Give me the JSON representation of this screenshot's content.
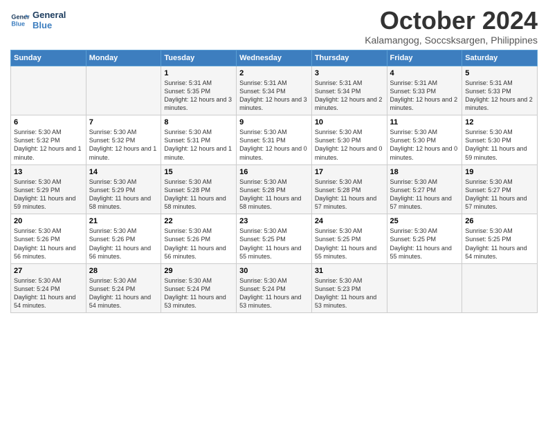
{
  "header": {
    "logo_line1": "General",
    "logo_line2": "Blue",
    "month": "October 2024",
    "location": "Kalamangog, Soccsksargen, Philippines"
  },
  "days_of_week": [
    "Sunday",
    "Monday",
    "Tuesday",
    "Wednesday",
    "Thursday",
    "Friday",
    "Saturday"
  ],
  "weeks": [
    [
      {
        "day": "",
        "info": ""
      },
      {
        "day": "",
        "info": ""
      },
      {
        "day": "1",
        "info": "Sunrise: 5:31 AM\nSunset: 5:35 PM\nDaylight: 12 hours and 3 minutes."
      },
      {
        "day": "2",
        "info": "Sunrise: 5:31 AM\nSunset: 5:34 PM\nDaylight: 12 hours and 3 minutes."
      },
      {
        "day": "3",
        "info": "Sunrise: 5:31 AM\nSunset: 5:34 PM\nDaylight: 12 hours and 2 minutes."
      },
      {
        "day": "4",
        "info": "Sunrise: 5:31 AM\nSunset: 5:33 PM\nDaylight: 12 hours and 2 minutes."
      },
      {
        "day": "5",
        "info": "Sunrise: 5:31 AM\nSunset: 5:33 PM\nDaylight: 12 hours and 2 minutes."
      }
    ],
    [
      {
        "day": "6",
        "info": "Sunrise: 5:30 AM\nSunset: 5:32 PM\nDaylight: 12 hours and 1 minute."
      },
      {
        "day": "7",
        "info": "Sunrise: 5:30 AM\nSunset: 5:32 PM\nDaylight: 12 hours and 1 minute."
      },
      {
        "day": "8",
        "info": "Sunrise: 5:30 AM\nSunset: 5:31 PM\nDaylight: 12 hours and 1 minute."
      },
      {
        "day": "9",
        "info": "Sunrise: 5:30 AM\nSunset: 5:31 PM\nDaylight: 12 hours and 0 minutes."
      },
      {
        "day": "10",
        "info": "Sunrise: 5:30 AM\nSunset: 5:30 PM\nDaylight: 12 hours and 0 minutes."
      },
      {
        "day": "11",
        "info": "Sunrise: 5:30 AM\nSunset: 5:30 PM\nDaylight: 12 hours and 0 minutes."
      },
      {
        "day": "12",
        "info": "Sunrise: 5:30 AM\nSunset: 5:30 PM\nDaylight: 11 hours and 59 minutes."
      }
    ],
    [
      {
        "day": "13",
        "info": "Sunrise: 5:30 AM\nSunset: 5:29 PM\nDaylight: 11 hours and 59 minutes."
      },
      {
        "day": "14",
        "info": "Sunrise: 5:30 AM\nSunset: 5:29 PM\nDaylight: 11 hours and 58 minutes."
      },
      {
        "day": "15",
        "info": "Sunrise: 5:30 AM\nSunset: 5:28 PM\nDaylight: 11 hours and 58 minutes."
      },
      {
        "day": "16",
        "info": "Sunrise: 5:30 AM\nSunset: 5:28 PM\nDaylight: 11 hours and 58 minutes."
      },
      {
        "day": "17",
        "info": "Sunrise: 5:30 AM\nSunset: 5:28 PM\nDaylight: 11 hours and 57 minutes."
      },
      {
        "day": "18",
        "info": "Sunrise: 5:30 AM\nSunset: 5:27 PM\nDaylight: 11 hours and 57 minutes."
      },
      {
        "day": "19",
        "info": "Sunrise: 5:30 AM\nSunset: 5:27 PM\nDaylight: 11 hours and 57 minutes."
      }
    ],
    [
      {
        "day": "20",
        "info": "Sunrise: 5:30 AM\nSunset: 5:26 PM\nDaylight: 11 hours and 56 minutes."
      },
      {
        "day": "21",
        "info": "Sunrise: 5:30 AM\nSunset: 5:26 PM\nDaylight: 11 hours and 56 minutes."
      },
      {
        "day": "22",
        "info": "Sunrise: 5:30 AM\nSunset: 5:26 PM\nDaylight: 11 hours and 56 minutes."
      },
      {
        "day": "23",
        "info": "Sunrise: 5:30 AM\nSunset: 5:25 PM\nDaylight: 11 hours and 55 minutes."
      },
      {
        "day": "24",
        "info": "Sunrise: 5:30 AM\nSunset: 5:25 PM\nDaylight: 11 hours and 55 minutes."
      },
      {
        "day": "25",
        "info": "Sunrise: 5:30 AM\nSunset: 5:25 PM\nDaylight: 11 hours and 55 minutes."
      },
      {
        "day": "26",
        "info": "Sunrise: 5:30 AM\nSunset: 5:25 PM\nDaylight: 11 hours and 54 minutes."
      }
    ],
    [
      {
        "day": "27",
        "info": "Sunrise: 5:30 AM\nSunset: 5:24 PM\nDaylight: 11 hours and 54 minutes."
      },
      {
        "day": "28",
        "info": "Sunrise: 5:30 AM\nSunset: 5:24 PM\nDaylight: 11 hours and 54 minutes."
      },
      {
        "day": "29",
        "info": "Sunrise: 5:30 AM\nSunset: 5:24 PM\nDaylight: 11 hours and 53 minutes."
      },
      {
        "day": "30",
        "info": "Sunrise: 5:30 AM\nSunset: 5:24 PM\nDaylight: 11 hours and 53 minutes."
      },
      {
        "day": "31",
        "info": "Sunrise: 5:30 AM\nSunset: 5:23 PM\nDaylight: 11 hours and 53 minutes."
      },
      {
        "day": "",
        "info": ""
      },
      {
        "day": "",
        "info": ""
      }
    ]
  ]
}
